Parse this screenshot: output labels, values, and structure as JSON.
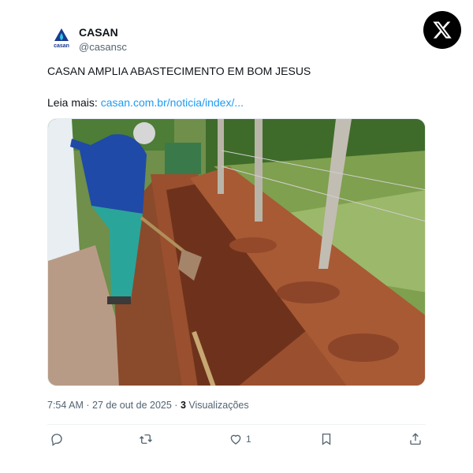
{
  "author": {
    "display_name": "CASAN",
    "handle": "@casansc",
    "avatar_text": "casan"
  },
  "tweet": {
    "headline": "CASAN AMPLIA ABASTECIMENTO EM BOM JESUS",
    "read_more_label": "Leia mais:",
    "link_text": "casan.com.br/noticia/index/..."
  },
  "meta": {
    "time": "7:54 AM",
    "separator": "·",
    "date": "27 de out de 2025",
    "views_count": "3",
    "views_label": "Visualizações"
  },
  "actions": {
    "reply_count": "",
    "retweet_count": "",
    "like_count": "1",
    "bookmark_count": "",
    "share_count": ""
  },
  "colors": {
    "link": "#1d9bf0",
    "secondary_text": "#536471",
    "brand_blue": "#1a3a8f"
  },
  "icons": [
    "casan-logo-icon",
    "x-logo-icon",
    "reply-icon",
    "retweet-icon",
    "like-icon",
    "bookmark-icon",
    "share-icon"
  ]
}
